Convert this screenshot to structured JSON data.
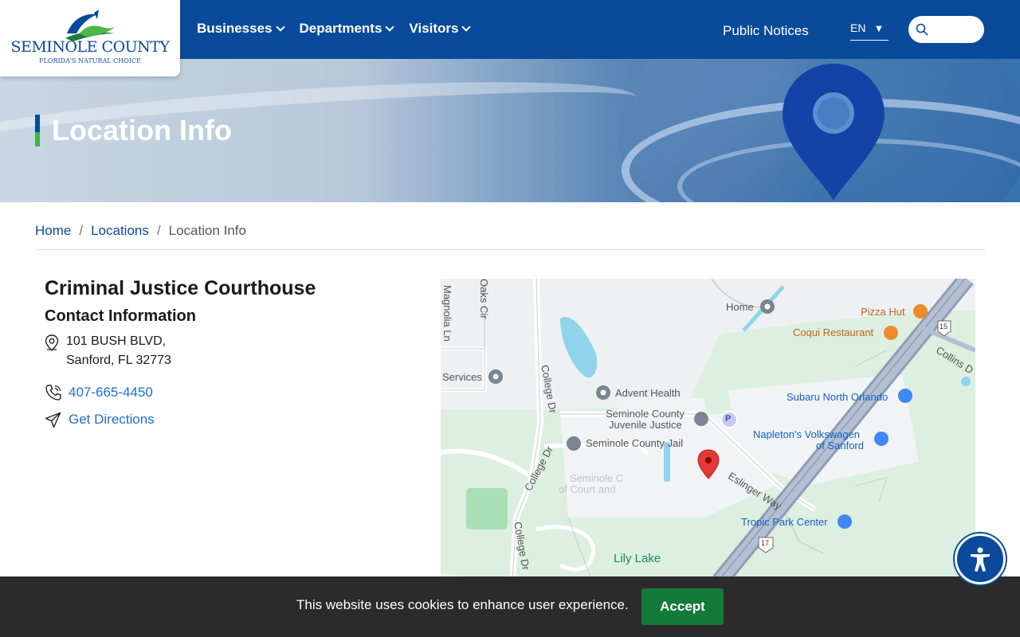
{
  "header": {
    "logo": {
      "name": "SEMINOLE COUNTY",
      "tagline": "FLORIDA'S NATURAL CHOICE"
    },
    "nav": [
      {
        "label": "Businesses"
      },
      {
        "label": "Departments"
      },
      {
        "label": "Visitors"
      }
    ],
    "public_notices": "Public Notices",
    "language": "EN",
    "search_icon": "search-icon"
  },
  "hero": {
    "title": "Location Info"
  },
  "breadcrumb": {
    "items": [
      "Home",
      "Locations"
    ],
    "current": "Location Info",
    "separator": "/"
  },
  "location": {
    "name": "Criminal Justice Courthouse",
    "contact_heading": "Contact Information",
    "address_line1": "101 BUSH BLVD,",
    "address_line2": "Sanford, FL 32773",
    "phone": "407-665-4450",
    "directions_label": "Get Directions"
  },
  "map": {
    "labels": {
      "magnolia": "Magnolia Ln",
      "oaks": "Oaks Cir",
      "college1": "College Dr",
      "college2": "College Dr",
      "college3": "College Dr",
      "services": "Services",
      "home": "Home",
      "pizza": "Pizza Hut",
      "coqui": "Coqui Restaurant",
      "collins": "Collins D",
      "advent": "Advent Health",
      "subaru": "Subaru North Orlando",
      "juvenile1": "Seminole County",
      "juvenile2": "Juvenile Justice",
      "jail": "Seminole County Jail",
      "napleton1": "Napleton's Volkswagen",
      "napleton2": "of Sanford",
      "eslinger": "Eslinger Way",
      "court1": "Seminole C",
      "court2": "of Court and",
      "tropic": "Tropic Park Center",
      "lily": "Lily Lake",
      "route15": "15",
      "route17": "17",
      "parking": "P"
    }
  },
  "cookie": {
    "message": "This website uses cookies to enhance user experience.",
    "accept": "Accept"
  },
  "colors": {
    "brand_blue": "#0a4a9b",
    "brand_green": "#3bb54a",
    "link_blue": "#1e6fd0",
    "accept_green": "#137a3a",
    "cookie_bg": "#2b2b2b",
    "map_pin_red": "#e53935"
  }
}
